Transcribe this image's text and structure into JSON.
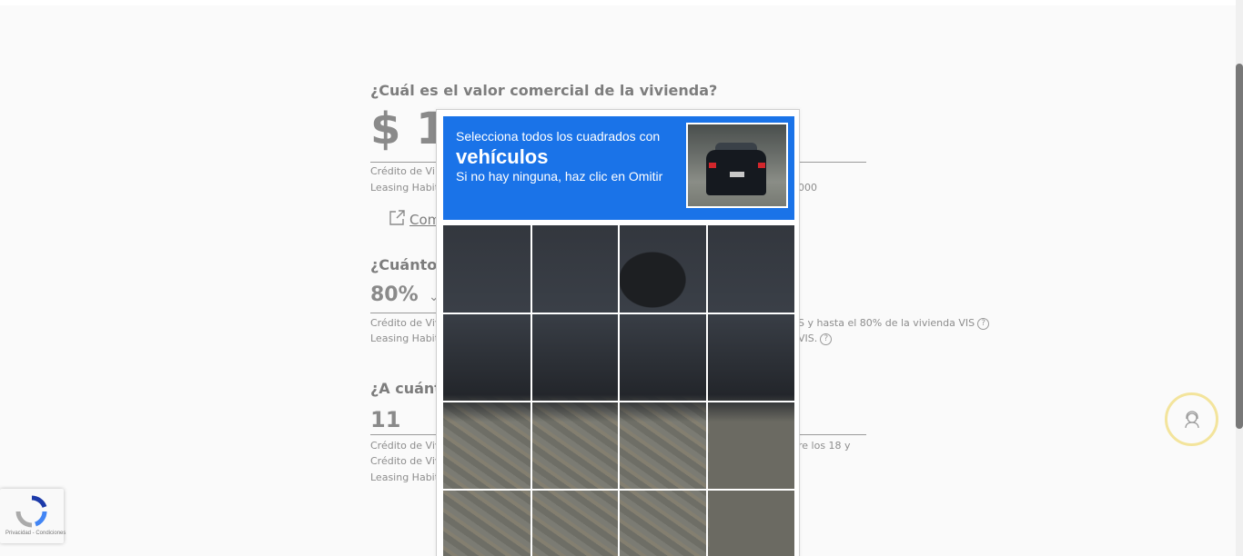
{
  "form": {
    "q1": "¿Cuál es el valor comercial de la vivienda?",
    "q1_value": "$ 1",
    "q1_note1": "Crédito de Vi",
    "q1_note2": "Leasing Habit",
    "q1_note2_right": "000",
    "q1_link": "Com",
    "q2": "¿Cuánto c",
    "q2_value": "80%",
    "q2_note1": "Crédito de Viv",
    "q2_note1_right": "S y hasta el 80% de la vivienda VIS",
    "q2_note2": "Leasing Habit",
    "q2_note2_right": "VIS.",
    "q3": "¿A cuánto",
    "q3_value": "11",
    "q3_note1": "Crédito de Viv",
    "q3_note1_right": "re los 18 y",
    "q3_note2": "Crédito de Viv",
    "q3_note3": "Leasing Habit",
    "help_glyph": "?"
  },
  "captcha": {
    "instruction": "Selecciona todos los cuadrados con",
    "target": "vehículos",
    "skip_hint": "Si no hay ninguna, haz clic en Omitir",
    "header_color": "#1a73e8",
    "grid_rows": 4,
    "grid_cols": 4
  },
  "badge": {
    "text": "Privacidad - Condiciones"
  },
  "icons": {
    "external_link": "external-link-icon",
    "chevron": "chevron-down-icon",
    "support": "support-agent-icon",
    "recaptcha": "recaptcha-logo-icon"
  }
}
